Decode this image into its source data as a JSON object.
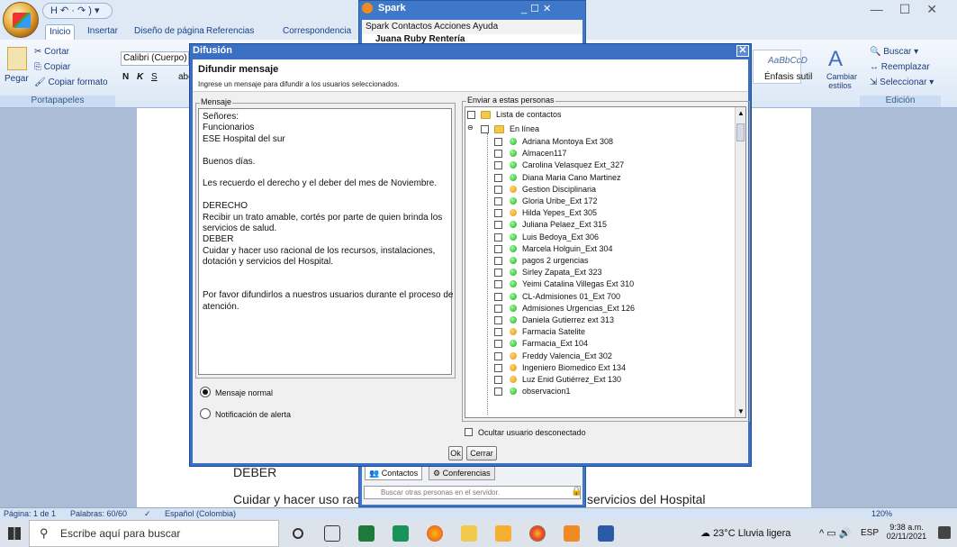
{
  "word": {
    "qat_label": "H ↶ · ↷ ) ▾",
    "tabs": [
      "Inicio",
      "Insertar",
      "Diseño de página",
      "Referencias",
      "Correspondencia"
    ],
    "clipboard": {
      "cut": "Cortar",
      "copy": "Copiar",
      "paste": "Pegar",
      "format_painter": "Copiar formato",
      "group": "Portapapeles"
    },
    "font": {
      "name": "Calibri (Cuerpo)",
      "bold": "N",
      "italic": "K",
      "underline": "S",
      "more": "abe"
    },
    "styles": {
      "preview": "AaBbCcD",
      "name": "Énfasis sutil",
      "change": "Cambiar",
      "change2": "estilos"
    },
    "editing": {
      "find": "Buscar",
      "replace": "Reemplazar",
      "select": "Seleccionar",
      "group": "Edición"
    },
    "doc_lines": {
      "deber": "DEBER",
      "cuidar": "Cuidar y hacer uso racio",
      "servicios": "servicios del Hospital"
    },
    "status": {
      "page": "Página: 1 de 1",
      "words": "Palabras: 60/60",
      "lang": "Español (Colombia)",
      "zoom": "120%"
    }
  },
  "spark": {
    "title": "Spark",
    "menu": [
      "Spark",
      "Contactos",
      "Acciones",
      "Ayuda"
    ],
    "user": "Juana Ruby Rentería",
    "tabs": [
      "Contactos",
      "Conferencias"
    ],
    "search_placeholder": "Buscar otras personas en el servidor."
  },
  "dialog": {
    "title": "Difusión",
    "heading": "Difundir mensaje",
    "subheading": "Ingrese un mensaje para difundir a los usuarios seleccionados.",
    "message_legend": "Mensaje",
    "message_lines": [
      "Señores:",
      "Funcionarios",
      "ESE Hospital del sur",
      "",
      "Buenos días.",
      "",
      "Les recuerdo el derecho y el deber del mes de Noviembre.",
      "",
      "DERECHO",
      "Recibir un trato amable, cortés por parte de quien brinda los",
      "servicios de salud.",
      "DEBER",
      "Cuidar y hacer uso racional de los recursos, instalaciones,",
      "dotación y servicios del Hospital.",
      "",
      "",
      "Por favor difundirlos a nuestros usuarios durante el proceso de",
      "atención."
    ],
    "radio_normal": "Mensaje normal",
    "radio_alert": "Notificación de alerta",
    "send_legend": "Enviar a estas personas",
    "contact_list_label": "Lista de contactos",
    "online_label": "En línea",
    "contacts": [
      {
        "name": "Adriana Montoya Ext 308",
        "status": "green"
      },
      {
        "name": "Almacen117",
        "status": "green"
      },
      {
        "name": "Carolina Velasquez Ext_327",
        "status": "green"
      },
      {
        "name": "Diana Maria Cano Martinez",
        "status": "green"
      },
      {
        "name": "Gestion Disciplinaria",
        "status": "orange"
      },
      {
        "name": "Gloria Uribe_Ext 172",
        "status": "green"
      },
      {
        "name": "Hilda Yepes_Ext 305",
        "status": "orange"
      },
      {
        "name": "Juliana Pelaez_Ext 315",
        "status": "green"
      },
      {
        "name": "Luis Bedoya_Ext 306",
        "status": "green"
      },
      {
        "name": "Marcela Holguin_Ext 304",
        "status": "green"
      },
      {
        "name": "pagos 2 urgencias",
        "status": "green"
      },
      {
        "name": "Sirley Zapata_Ext 323",
        "status": "green"
      },
      {
        "name": "Yeimi Catalina Villegas Ext  310",
        "status": "green"
      },
      {
        "name": "CL-Admisiones 01_Ext 700",
        "status": "green"
      },
      {
        "name": "Admisiones Urgencias_Ext 126",
        "status": "green"
      },
      {
        "name": "Daniela Gutierrez ext 313",
        "status": "green"
      },
      {
        "name": "Farmacia Satelite",
        "status": "orange"
      },
      {
        "name": "Farmacia_Ext 104",
        "status": "green"
      },
      {
        "name": "Freddy Valencia_Ext 302",
        "status": "orange"
      },
      {
        "name": "Ingeniero Biomedico Ext 134",
        "status": "orange"
      },
      {
        "name": "Luz Enid Gutiérrez_Ext 130",
        "status": "orange"
      },
      {
        "name": "observacion1",
        "status": "green"
      }
    ],
    "hide_offline": "Ocultar usuario desconectado",
    "ok": "Ok",
    "close": "Cerrar"
  },
  "taskbar": {
    "search_placeholder": "Escribe aquí para buscar",
    "weather": "23°C  Lluvia ligera",
    "lang": "ESP",
    "time": "9:38 a.m.",
    "date": "02/11/2021"
  }
}
